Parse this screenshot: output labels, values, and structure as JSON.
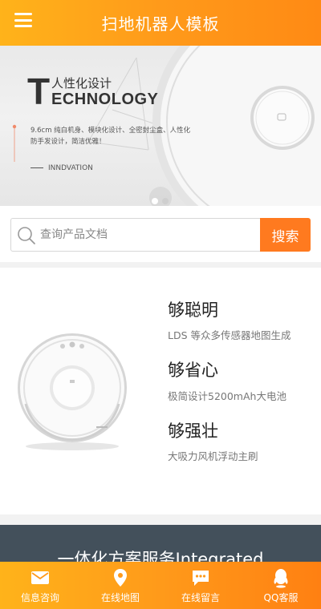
{
  "header": {
    "title": "扫地机器人模板"
  },
  "banner": {
    "big_letter": "T",
    "subtitle": "人性化设计",
    "tech_word": "ECHNOLOGY",
    "description": "9.6cm 纯白机身、模块化设计、全密封尘盒、人性化防手发设计，简洁优雅！",
    "innovation": "INNDVATION"
  },
  "search": {
    "placeholder": "查询产品文档",
    "button_label": "搜索"
  },
  "features": [
    {
      "title": "够聪明",
      "desc": "LDS 等众多传感器地图生成"
    },
    {
      "title": "够省心",
      "desc": "极简设计5200mAh大电池"
    },
    {
      "title": "够强壮",
      "desc": "大吸力风机浮动主刷"
    }
  ],
  "dark_section": {
    "title": "一体化方案服务Integrated"
  },
  "bottom_nav": [
    {
      "label": "信息咨询",
      "icon": "mail-icon"
    },
    {
      "label": "在线地图",
      "icon": "map-pin-icon"
    },
    {
      "label": "在线留言",
      "icon": "chat-icon"
    },
    {
      "label": "QQ客服",
      "icon": "qq-icon"
    }
  ],
  "colors": {
    "brand_orange": "#ff8a14",
    "search_button": "#ff7a1f",
    "dark_band": "#43505b"
  }
}
